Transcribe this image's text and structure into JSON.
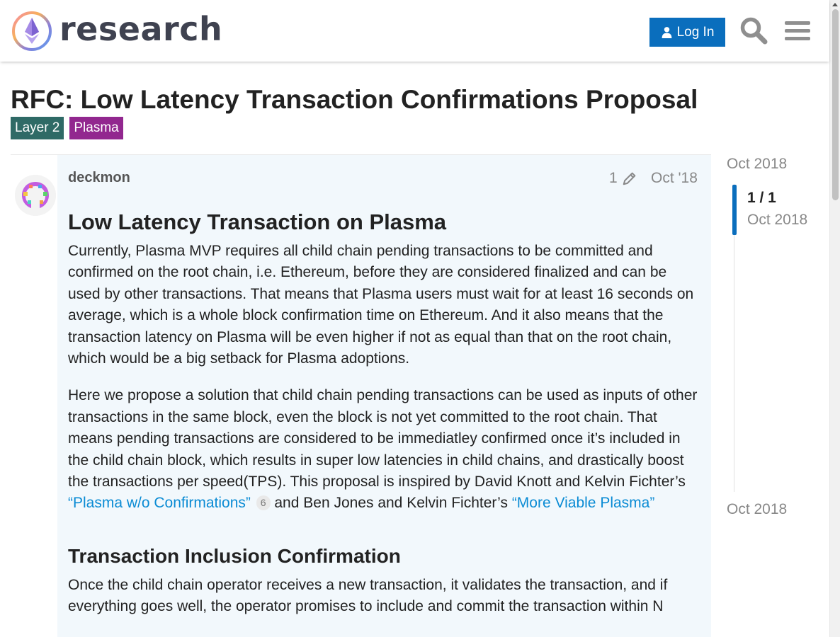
{
  "header": {
    "logo_text": "research",
    "login_label": "Log In",
    "brand_color": "#0a6ebd"
  },
  "topic": {
    "title": "RFC: Low Latency Transaction Confirmations Proposal",
    "tags": [
      {
        "label": "Layer 2",
        "color": "#2f6a66"
      },
      {
        "label": "Plasma",
        "color": "#92278f"
      }
    ]
  },
  "post": {
    "username": "deckmon",
    "edit_count": "1",
    "date": "Oct '18",
    "heading1": "Low Latency Transaction on Plasma",
    "para1": "Currently, Plasma MVP requires all child chain pending transactions to be committed and confirmed on the root chain, i.e. Ethereum, before they are considered finalized and can be used by other transactions. That means that Plasma users must wait for at least 16 seconds on average, which is a whole block confirmation time on Ethereum. And it also means that the transaction latency on Plasma will be even higher if not as equal than that on the root chain, which would be a big setback for Plasma adoptions.",
    "para2_a": "Here we propose a solution that child chain pending transactions can be used as inputs of other transactions in the same block, even the block is not yet committed to the root chain. That means pending transactions are considered to be immediatley confirmed once it’s included in the child chain block, which results in super low latencies in child chains, and drastically boost the transactions per speed(TPS). This proposal is inspired by David Knott and Kelvin Fichter’s ",
    "link1": "“Plasma w/o Confirmations”",
    "link1_clicks": "6",
    "para2_b": " and Ben Jones and Kelvin Fichter’s ",
    "link2": "“More Viable Plasma”",
    "heading2": "Transaction Inclusion Confirmation",
    "para3": "Once the child chain operator receives a new transaction, it validates the transaction, and if everything goes well, the operator promises to include and commit the transaction within N"
  },
  "timeline": {
    "top_date": "Oct 2018",
    "position": "1 / 1",
    "position_date": "Oct 2018",
    "bottom_date": "Oct 2018"
  },
  "icons": {
    "logo": "ethereum-research-logo",
    "user": "user-icon",
    "search": "search-icon",
    "menu": "hamburger-menu-icon",
    "edit": "pencil-icon"
  }
}
